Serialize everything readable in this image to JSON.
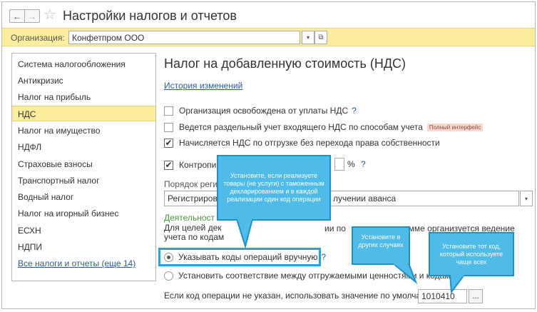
{
  "window": {
    "title": "Настройки налогов и отчетов",
    "nav_back": "←",
    "nav_forward": "→",
    "star": "☆"
  },
  "org": {
    "label": "Организация:",
    "value": "Конфетпром ООО",
    "drop_glyph": "▾",
    "open_glyph": "⧉"
  },
  "sidebar": {
    "items": [
      {
        "label": "Система налогообложения"
      },
      {
        "label": "Антикризис"
      },
      {
        "label": "Налог на прибыль"
      },
      {
        "label": "НДС"
      },
      {
        "label": "Налог на имущество"
      },
      {
        "label": "НДФЛ"
      },
      {
        "label": "Страховые взносы"
      },
      {
        "label": "Транспортный налог"
      },
      {
        "label": "Водный налог"
      },
      {
        "label": "Налог на игорный бизнес"
      },
      {
        "label": "ЕСХН"
      },
      {
        "label": "НДПИ"
      },
      {
        "label": "Все налоги и отчеты (еще 14)"
      }
    ],
    "active_index": 3
  },
  "main": {
    "title": "Налог на добавленную стоимость (НДС)",
    "history_link": "История изменений",
    "checkboxes": [
      {
        "label": "Организация освобождена от уплаты НДС",
        "checked": false,
        "help": "?",
        "checkmark": ""
      },
      {
        "label": "Ведется раздельный учет входящего НДС по способам учета",
        "checked": false,
        "badge": "Полный интерфейс",
        "checkmark": ""
      },
      {
        "label": "Начисляется НДС по отгрузке без перехода права собственности",
        "checked": true,
        "checkmark": "✔"
      },
      {
        "label": "Контропир",
        "checked": true,
        "checkmark": "✔"
      }
    ],
    "percent_suffix": "%",
    "percent_help": "?",
    "order_label": "Порядок регис",
    "order_select": "Регистрирова",
    "order_select_tail": "лучении аванса",
    "order_drop": "▾",
    "activity_label": "Деятельност",
    "paragraph_left": "Для целей дек",
    "paragraph_mid": "ии по",
    "paragraph_right": "амме организуется ведение",
    "paragraph_line2": "учета по кодам",
    "radio_manual": "Указывать коды операций вручную",
    "radio_manual_help": "?",
    "radio_auto": "Установить соответствие между отгружаемыми ценностями и кодами",
    "default_label": "Если код операции не указан, использовать значение по умолчанию:",
    "default_code": "1010410",
    "default_btn": "..."
  },
  "callouts": {
    "customs": "Установите, если реализуете товары (не услуги) с таможенным декларированием и в каждой реализации один код операции",
    "other": "Установите в других случаях",
    "frequent": "Установите тот код, который используете чаще всех"
  },
  "colors": {
    "accent_yellow": "#fbed9e",
    "callout_blue": "#4fbbe8",
    "highlight_blue": "#27a3dc",
    "link_blue": "#2a5d9f"
  }
}
